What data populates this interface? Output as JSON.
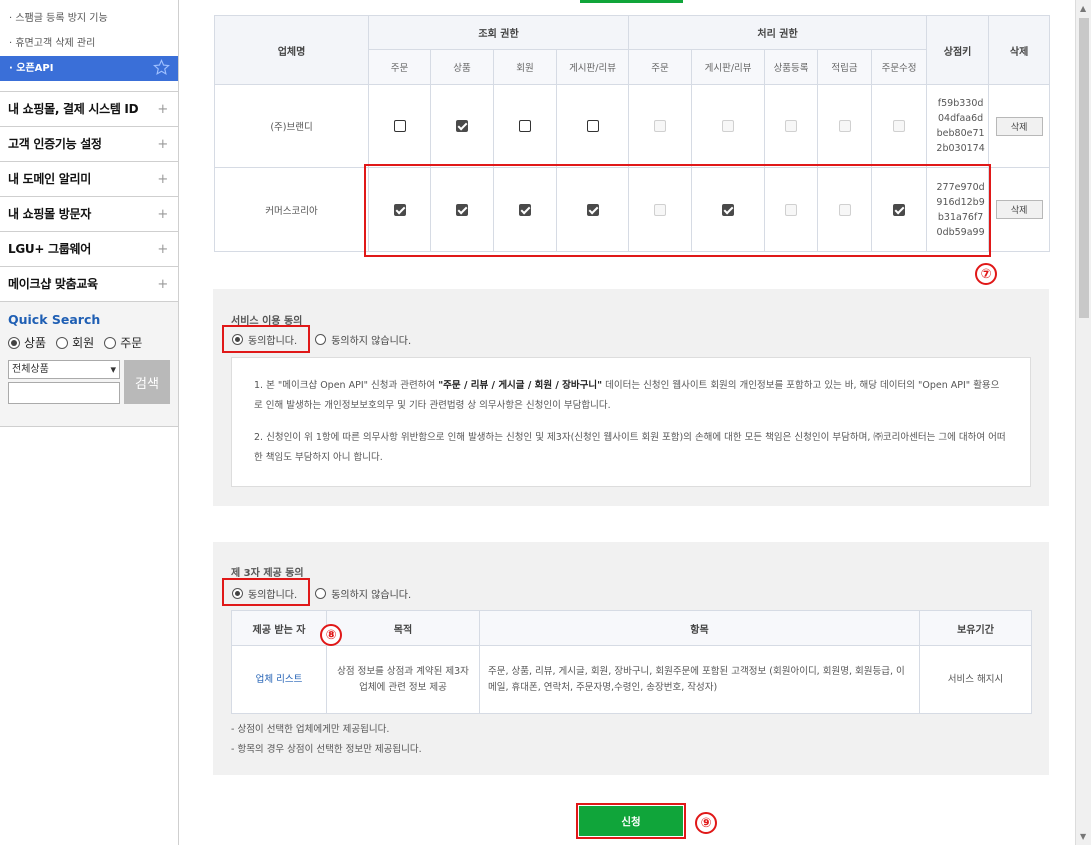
{
  "sidebar": {
    "sub_items": [
      {
        "label": "· 스팸글 등록 방지 기능"
      },
      {
        "label": "· 휴면고객 삭제 관리"
      },
      {
        "label": "· 오픈API"
      }
    ],
    "menus": [
      {
        "label": "내 쇼핑몰, 결제 시스템 ID"
      },
      {
        "label": "고객 인증기능 설정"
      },
      {
        "label": "내 도메인 알리미"
      },
      {
        "label": "내 쇼핑몰 방문자"
      },
      {
        "label": "LGU+ 그룹웨어"
      },
      {
        "label": "메이크샵 맞춤교육"
      }
    ],
    "plus": "+",
    "quick_search": {
      "title": "Quick Search",
      "options": [
        "상품",
        "회원",
        "주문"
      ],
      "selected": "상품",
      "select_value": "전체상품",
      "button": "검색"
    }
  },
  "api_table": {
    "headers": {
      "company": "업체명",
      "view_group": "조회 권한",
      "process_group": "처리 권한",
      "shopkey": "상점키",
      "delete": "삭제",
      "view_cols": [
        "주문",
        "상품",
        "회원",
        "게시판/리뷰"
      ],
      "process_cols": [
        "주문",
        "게시판/리뷰",
        "상품등록",
        "적립금",
        "주문수정"
      ]
    },
    "rows": [
      {
        "company": "(주)브랜디",
        "view": [
          false,
          true,
          false,
          false
        ],
        "process": [
          false,
          false,
          false,
          false,
          false
        ],
        "shopkey": [
          "f59b330d",
          "04dfaa6d",
          "beb80e71",
          "2b030174"
        ],
        "delete": "삭제"
      },
      {
        "company": "커머스코리아",
        "view": [
          true,
          true,
          true,
          true
        ],
        "process": [
          false,
          true,
          false,
          false,
          true
        ],
        "shopkey": [
          "277e970d",
          "916d12b9",
          "b31a76f7",
          "0db59a99"
        ],
        "delete": "삭제"
      }
    ]
  },
  "markers": {
    "m7": "⑦",
    "m8": "⑧",
    "m9": "⑨"
  },
  "service_agreement": {
    "title": "서비스 이용 동의",
    "agree": "동의합니다.",
    "disagree": "동의하지 않습니다.",
    "term1_a": "1. 본 \"메이크샵 Open API\" 신청과 관련하여 ",
    "term1_bold": "\"주문 / 리뷰 / 게시글 / 회원 / 장바구니\"",
    "term1_b": " 데이터는 신청인 웹사이트 회원의 개인정보를 포함하고 있는 바, 해당 데이터의 \"Open API\" 활용으로 인해 발생하는 개인정보보호의무 및 기타 관련법령 상 의무사항은 신청인이 부담합니다.",
    "term2": "2. 신청인이 위 1항에 따른 의무사항 위반함으로 인해 발생하는 신청인 및 제3자(신청인 웹사이트 회원 포함)의 손해에 대한 모든 책임은 신청인이 부담하며, ㈜코리아센터는 그에 대하여 어떠한 책임도 부담하지 아니 합니다."
  },
  "third_party": {
    "title": "제 3자 제공 동의",
    "agree": "동의합니다.",
    "disagree": "동의하지 않습니다.",
    "headers": [
      "제공 받는 자",
      "목적",
      "항목",
      "보유기간"
    ],
    "recipient": "업체 리스트",
    "purpose": "상점 정보를 상점과 계약된 제3자 업체에 관련 정보 제공",
    "items": "주문, 상품, 리뷰, 게시글, 회원, 장바구니, 회원주문에 포함된 고객정보 (회원아이디, 회원명, 회원등급, 이메일, 휴대폰, 연락처, 주문자명,수령인, 송장번호, 작성자)",
    "period": "서비스 해지시",
    "notes": [
      "- 상점이 선택한 업체에게만 제공됩니다.",
      "- 항목의 경우 상점이 선택한 정보만 제공됩니다."
    ]
  },
  "apply_button": "신청"
}
